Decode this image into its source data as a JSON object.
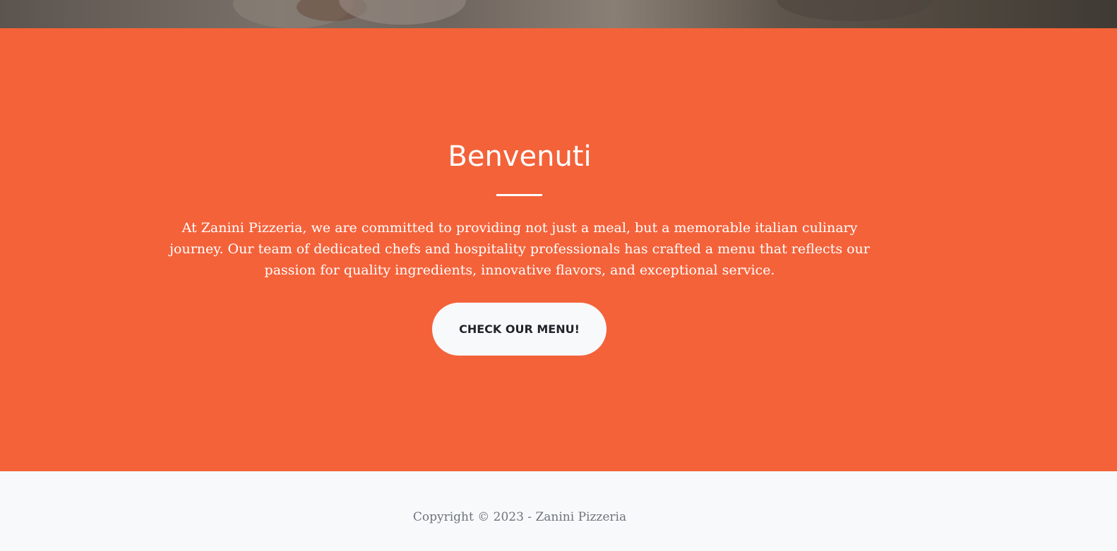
{
  "about": {
    "heading": "Benvenuti",
    "text": "At Zanini Pizzeria, we are committed to providing not just a meal, but a memorable italian culinary journey. Our team of dedicated chefs and hospitality professionals has crafted a menu that reflects our passion for quality ingredients, innovative flavors, and exceptional service.",
    "button_label": "CHECK OUR MENU!"
  },
  "footer": {
    "copyright": "Copyright © 2023 - Zanini Pizzeria"
  },
  "colors": {
    "primary": "#f4623a",
    "light": "#f8f9fa",
    "muted": "#6c757d",
    "dark": "#212529"
  }
}
